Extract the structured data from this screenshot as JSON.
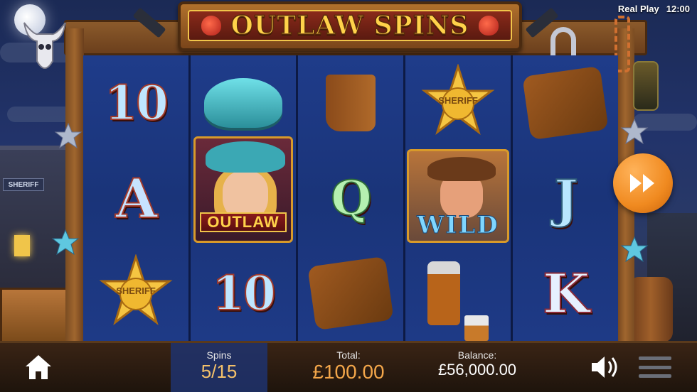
{
  "game": {
    "title": "OUTLAW SPINS"
  },
  "status": {
    "mode": "Real Play",
    "time": "12:00"
  },
  "reels": [
    [
      "10",
      "A",
      "SHERIFF"
    ],
    [
      "hat",
      "OUTLAW",
      "10"
    ],
    [
      "boots",
      "Q",
      "holster"
    ],
    [
      "SHERIFF",
      "WILD",
      "whiskey"
    ],
    [
      "holster",
      "J",
      "K"
    ]
  ],
  "symbols": {
    "sheriff_text": "SHERIFF",
    "outlaw_text": "OUTLAW",
    "wild_text": "WILD",
    "ten": "10",
    "a": "A",
    "q": "Q",
    "j": "J",
    "k": "K"
  },
  "scene": {
    "building_sign": "SHERIFF"
  },
  "hud": {
    "spins_label": "Spins",
    "spins_value": "5/15",
    "total_label": "Total:",
    "total_value": "£100.00",
    "balance_label": "Balance:",
    "balance_value": "£56,000.00"
  },
  "colors": {
    "accent": "#f08a20",
    "title_gold": "#ffd24a",
    "reel_blue": "#1f3c8a"
  }
}
